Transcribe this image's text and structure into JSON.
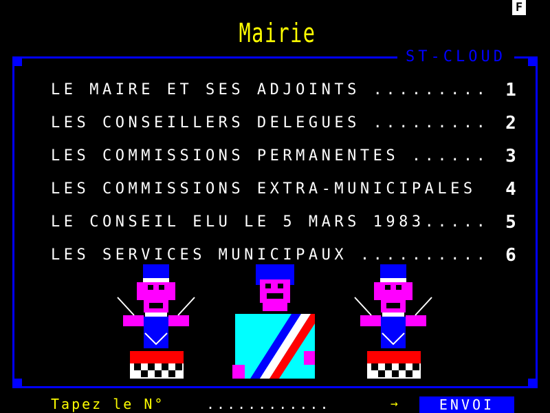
{
  "header": {
    "title": "Mairie",
    "city": "ST-CLOUD",
    "indicator": "F"
  },
  "menu": [
    {
      "label": "LE MAIRE ET SES ADJOINTS .........",
      "number": "1"
    },
    {
      "label": "LES CONSEILLERS DELEGUES .........",
      "number": "2"
    },
    {
      "label": "LES COMMISSIONS PERMANENTES ......",
      "number": "3"
    },
    {
      "label": "LES COMMISSIONS EXTRA-MUNICIPALES",
      "number": "4"
    },
    {
      "label": "LE CONSEIL ELU LE 5 MARS 1983.....",
      "number": "5"
    },
    {
      "label": "LES SERVICES MUNICIPAUX ..........",
      "number": "6"
    }
  ],
  "footer": {
    "prompt": "Tapez le N°",
    "dots": "............",
    "arrow": "→",
    "send_label": "ENVOI"
  },
  "colors": {
    "background": "#000000",
    "frame": "#0000ff",
    "title": "#ffff00",
    "text": "#ffffff",
    "figure_head": "#ff00ff",
    "figure_robe": "#00ffff",
    "sash_red": "#ff0000"
  }
}
